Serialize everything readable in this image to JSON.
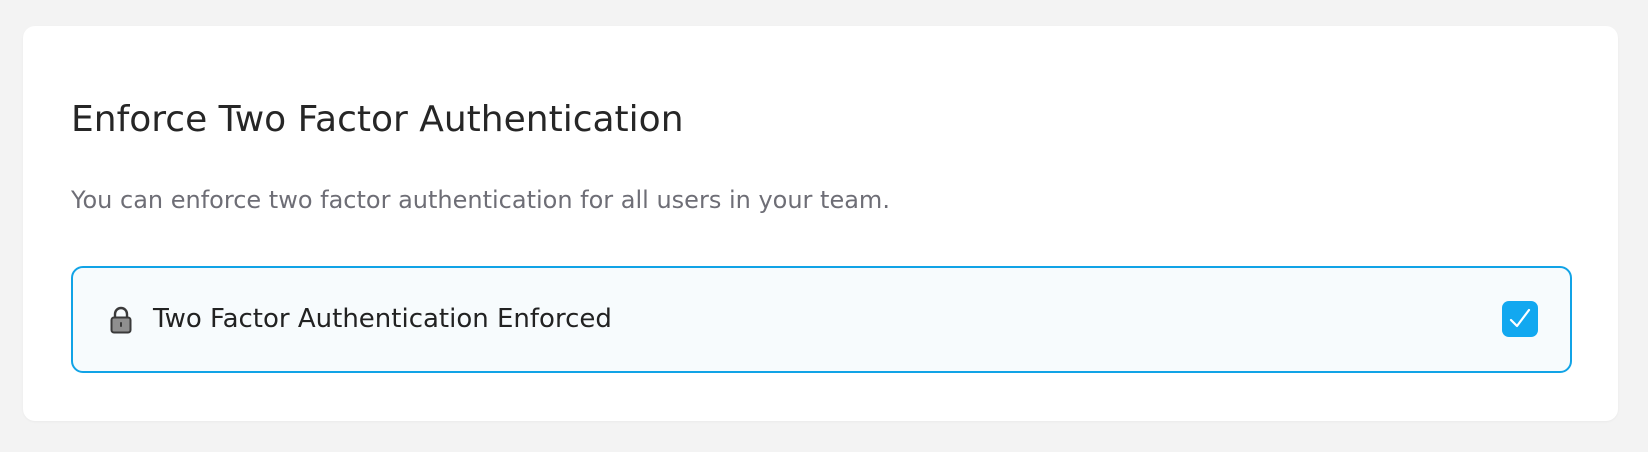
{
  "card": {
    "title": "Enforce Two Factor Authentication",
    "description": "You can enforce two factor authentication for all users in your team."
  },
  "option": {
    "icon": "lock-icon",
    "label": "Two Factor Authentication Enforced",
    "checked": true
  },
  "colors": {
    "accent": "#11a3e6",
    "checkbox_fill": "#12a8f0",
    "page_background": "#f3f3f3",
    "card_background": "#ffffff"
  }
}
